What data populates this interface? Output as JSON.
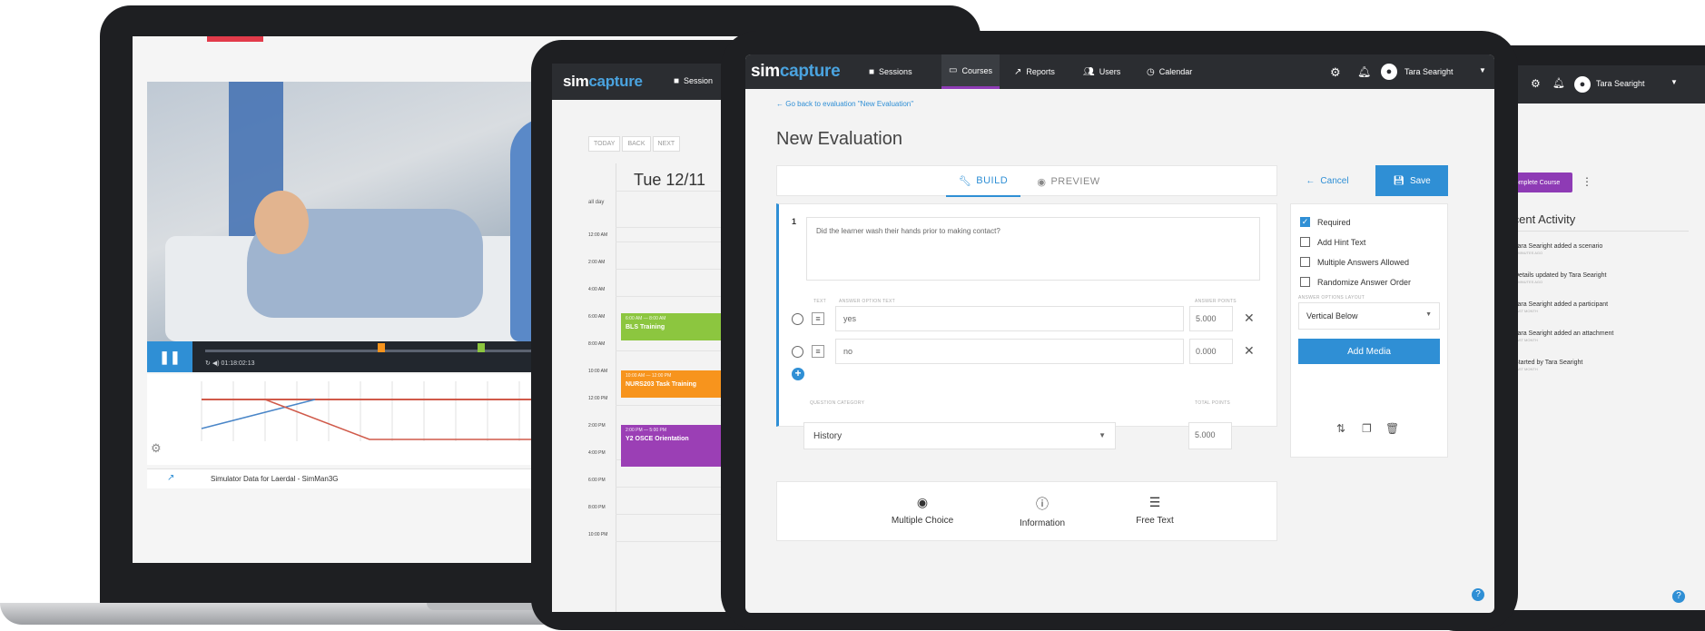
{
  "laptop": {
    "pause_icon": "pause-icon",
    "time": "01:18:02:13",
    "chart_footer": "Simulator Data for Laerdal - SimMan3G"
  },
  "calendar_tablet": {
    "logo_sim": "sim",
    "logo_capture": "capture",
    "nav_sessions": "Session",
    "btn_today": "TODAY",
    "btn_back": "BACK",
    "btn_next": "NEXT",
    "date": "Tue 12/11",
    "all_day": "all day",
    "times": [
      "12:00 AM",
      "2:00 AM",
      "4:00 AM",
      "6:00 AM",
      "8:00 AM",
      "10:00 AM",
      "12:00 PM",
      "2:00 PM",
      "4:00 PM",
      "6:00 PM",
      "8:00 PM",
      "10:00 PM"
    ],
    "events": [
      {
        "time": "6:00 AM — 8:00 AM",
        "name": "BLS Training",
        "color": "#8cc63f"
      },
      {
        "time": "10:00 AM — 12:00 PM",
        "name": "NURS203 Task Training",
        "color": "#f7941d"
      },
      {
        "time": "2:00 PM — 5:00 PM",
        "name": "Y2 OSCE Orientation",
        "color": "#9b3fb5"
      }
    ]
  },
  "activity_tablet": {
    "user": "Tara Searight",
    "complete_button": "Complete Course",
    "recent_title": "Recent Activity",
    "items": [
      {
        "text": "Tara Searight added a scenario",
        "when": "2 MINUTES AGO"
      },
      {
        "text": "Details updated by Tara Searight",
        "when": "2 MINUTES AGO"
      },
      {
        "text": "Tara Searight added a participant",
        "when": "LAST MONTH"
      },
      {
        "text": "Tara Searight added an attachment",
        "when": "LAST MONTH"
      },
      {
        "text": "Started by Tara Searight",
        "when": "LAST MONTH"
      }
    ]
  },
  "main": {
    "logo_sim": "sim",
    "logo_capture": "capture",
    "nav": {
      "sessions": "Sessions",
      "courses": "Courses",
      "reports": "Reports",
      "users": "Users",
      "calendar": "Calendar",
      "user": "Tara Searight"
    },
    "back_link": "← Go back to evaluation \"New Evaluation\"",
    "title": "New Evaluation",
    "tabs": {
      "build": "BUILD",
      "preview": "PREVIEW"
    },
    "cancel": "Cancel",
    "save": "Save",
    "question": {
      "number": "1",
      "text": "Did the learner wash their hands prior to making contact?",
      "col_text": "TEXT",
      "col_answer": "ANSWER OPTION TEXT",
      "col_points": "ANSWER POINTS",
      "answers": [
        {
          "text": "yes",
          "points": "5.000"
        },
        {
          "text": "no",
          "points": "0.000"
        }
      ],
      "category_label": "QUESTION CATEGORY",
      "category": "History",
      "total_label": "TOTAL POINTS",
      "total": "5.000"
    },
    "options": {
      "required": "Required",
      "hint": "Add Hint Text",
      "multiple": "Multiple Answers Allowed",
      "randomize": "Randomize Answer Order",
      "layout_label": "ANSWER OPTIONS LAYOUT",
      "layout_value": "Vertical Below",
      "add_media": "Add Media"
    },
    "question_types": {
      "multiple_choice": "Multiple Choice",
      "information": "Information",
      "free_text": "Free Text"
    },
    "help": "?"
  }
}
